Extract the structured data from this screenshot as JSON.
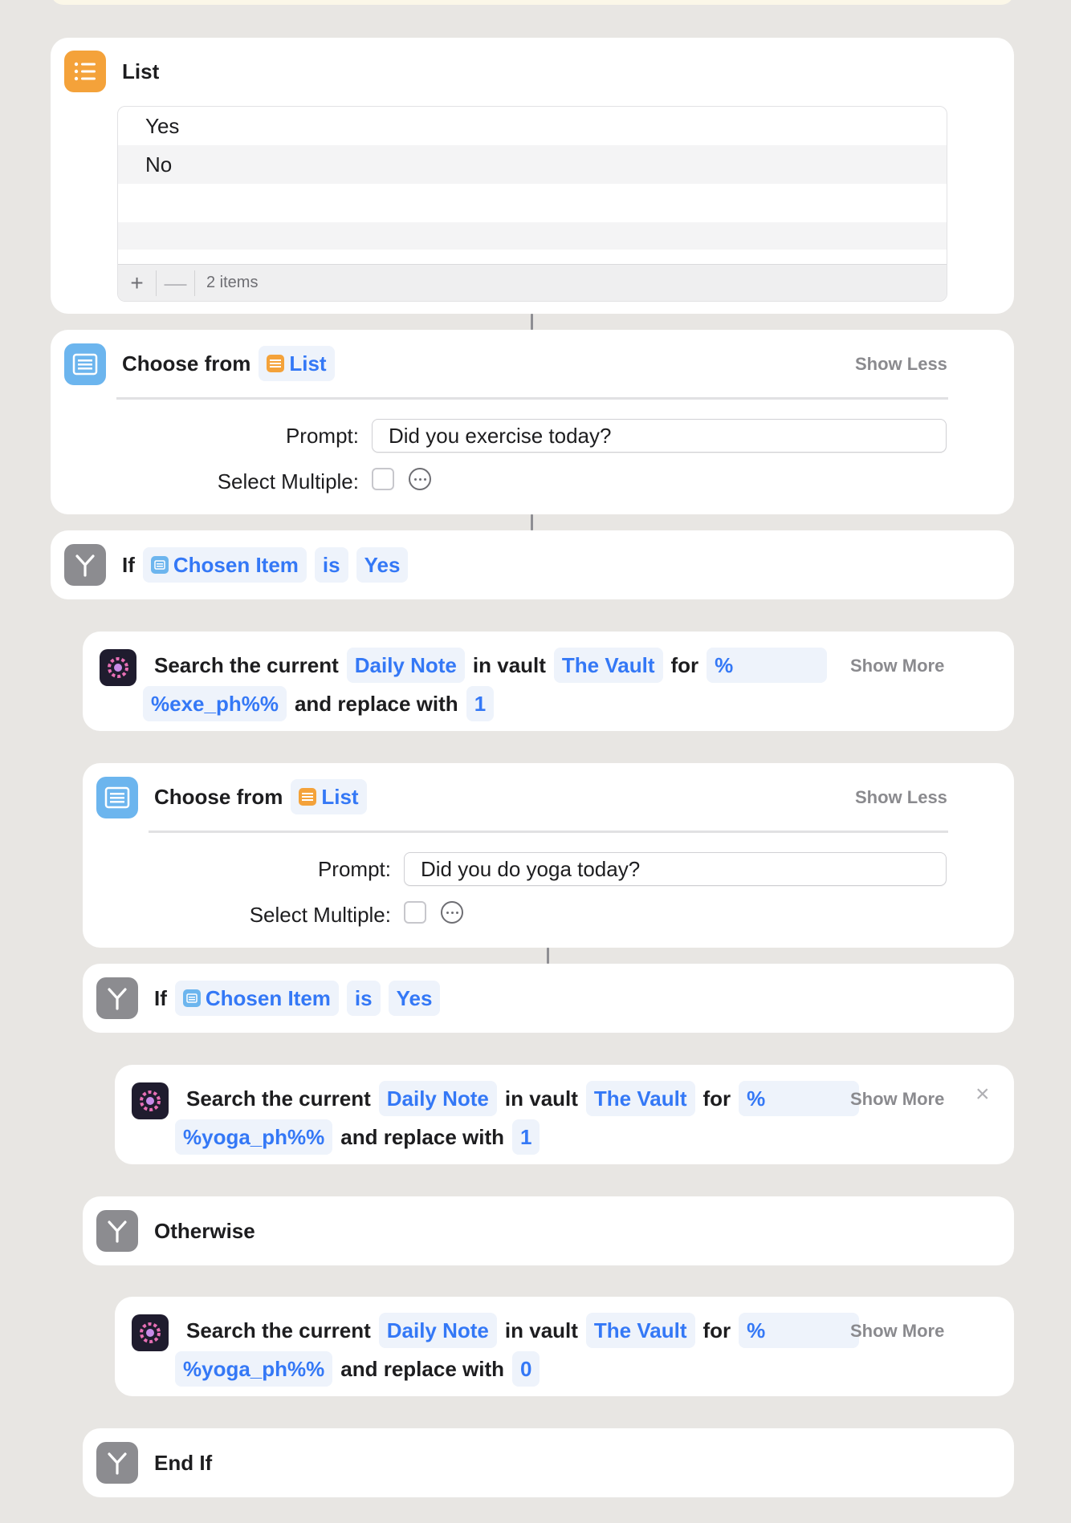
{
  "list_action": {
    "title": "List",
    "items": [
      "Yes",
      "No"
    ],
    "add_label": "+",
    "remove_label": "—",
    "count_label": "2 items"
  },
  "choose1": {
    "prefix": "Choose from",
    "source": "List",
    "show_label": "Show Less",
    "prompt_label": "Prompt:",
    "prompt_value": "Did you exercise today?",
    "select_multiple_label": "Select Multiple:"
  },
  "if1": {
    "keyword": "If",
    "variable": "Chosen Item",
    "operator": "is",
    "value": "Yes"
  },
  "search1": {
    "w1": "Search the current",
    "note": "Daily Note",
    "w2": "in vault",
    "vault": "The Vault",
    "w3": "for",
    "find_start": "%",
    "find_rest": "%exe_ph%%",
    "w4": "and replace with",
    "replace": "1",
    "show_label": "Show More"
  },
  "choose2": {
    "prefix": "Choose from",
    "source": "List",
    "show_label": "Show Less",
    "prompt_label": "Prompt:",
    "prompt_value": "Did you do yoga today?",
    "select_multiple_label": "Select Multiple:"
  },
  "if2": {
    "keyword": "If",
    "variable": "Chosen Item",
    "operator": "is",
    "value": "Yes"
  },
  "search2": {
    "w1": "Search the current",
    "note": "Daily Note",
    "w2": "in vault",
    "vault": "The Vault",
    "w3": "for",
    "find_start": "%",
    "find_rest": "%yoga_ph%%",
    "w4": "and replace with",
    "replace": "1",
    "show_label": "Show More",
    "close": "×"
  },
  "otherwise": {
    "label": "Otherwise"
  },
  "search3": {
    "w1": "Search the current",
    "note": "Daily Note",
    "w2": "in vault",
    "vault": "The Vault",
    "w3": "for",
    "find_start": "%",
    "find_rest": "%yoga_ph%%",
    "w4": "and replace with",
    "replace": "0",
    "show_label": "Show More"
  },
  "endif": {
    "label": "End If"
  },
  "icons": {
    "list": "list-icon",
    "choose": "choose-from-menu-icon",
    "if": "branch-icon",
    "app": "gear-flower-app-icon"
  },
  "colors": {
    "background": "#e8e6e3",
    "accent_blue": "#3478f6",
    "token_bg": "#eef3fb",
    "list_orange": "#f4a23a",
    "choose_blue": "#6cb5ee",
    "control_gray": "#8c8c90"
  }
}
